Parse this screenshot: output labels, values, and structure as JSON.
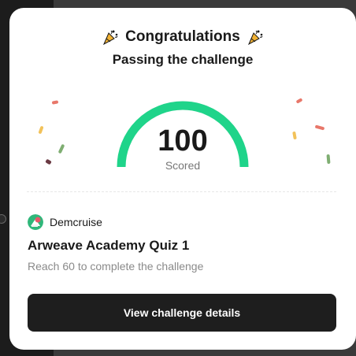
{
  "dialog": {
    "title": "Congratulations",
    "subtitle": "Passing the challenge",
    "title_icon": "party-popper-icon"
  },
  "result": {
    "score": "100",
    "score_label": "Scored",
    "progress_fraction": 1.0,
    "gauge_color": "#1fd48a"
  },
  "challenge": {
    "creator_name": "Demcruise",
    "quiz_title": "Arweave Academy Quiz 1",
    "requirement": "Reach 60 to complete the challenge"
  },
  "actions": {
    "details_label": "View challenge details"
  },
  "colors": {
    "button_bg": "#1e1e1e",
    "confetti_red": "#e8776a",
    "confetti_yellow": "#f2c25a",
    "confetti_green": "#7fae72",
    "confetti_maroon": "#6b3b44"
  }
}
